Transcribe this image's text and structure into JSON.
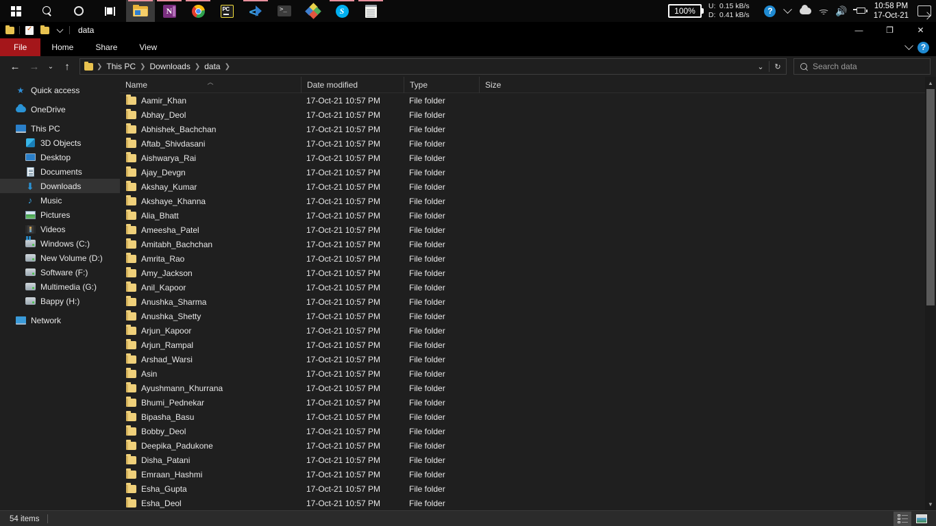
{
  "taskbar": {
    "start_icon": "windows-logo-icon",
    "items": [
      {
        "name": "start-button",
        "icon": "windows-logo-icon",
        "label": "Start"
      },
      {
        "name": "search-button",
        "icon": "search-icon",
        "label": "Search"
      },
      {
        "name": "cortana-button",
        "icon": "cortana-circle-icon",
        "label": "Cortana"
      },
      {
        "name": "task-view-button",
        "icon": "task-view-icon",
        "label": "Task View"
      }
    ],
    "apps": [
      {
        "name": "taskbar-app-file-explorer",
        "label": "File Explorer",
        "active": true
      },
      {
        "name": "taskbar-app-onenote",
        "label": "OneNote",
        "active": false
      },
      {
        "name": "taskbar-app-chrome",
        "label": "Google Chrome",
        "active": false
      },
      {
        "name": "taskbar-app-pycharm",
        "label": "PyCharm",
        "active": false
      },
      {
        "name": "taskbar-app-vscode",
        "label": "Visual Studio Code",
        "active": false
      },
      {
        "name": "taskbar-app-terminal",
        "label": "Terminal",
        "active": false
      },
      {
        "name": "taskbar-app-colorpicker",
        "label": "Color App",
        "active": false
      },
      {
        "name": "taskbar-app-skype",
        "label": "Skype",
        "active": false
      },
      {
        "name": "taskbar-app-notepad",
        "label": "Notepad",
        "active": false
      }
    ],
    "tray": {
      "battery_percent": "100%",
      "upload_label": "U:",
      "upload_value": "0.15 kB/s",
      "download_label": "D:",
      "download_value": "0.41 kB/s",
      "time": "10:58 PM",
      "date": "17-Oct-21",
      "icons": [
        "help-circle-icon",
        "chevron-up-icon",
        "onedrive-cloud-icon",
        "wifi-icon",
        "volume-icon",
        "battery-charging-icon",
        "action-center-icon"
      ]
    }
  },
  "window": {
    "title": "data",
    "quick_access": [
      "folder-icon",
      "properties-icon",
      "new-folder-icon",
      "customize-chevron-icon"
    ],
    "controls": {
      "minimize": "—",
      "maximize": "❐",
      "close": "✕"
    },
    "ribbon_tabs": [
      {
        "label": "File",
        "active": true
      },
      {
        "label": "Home",
        "active": false
      },
      {
        "label": "Share",
        "active": false
      },
      {
        "label": "View",
        "active": false
      }
    ],
    "ribbon_right": [
      "expand-ribbon-chevron-icon",
      "help-icon"
    ]
  },
  "nav": {
    "back": "←",
    "forward": "→",
    "recent": "⌄",
    "up": "↑",
    "breadcrumbs": [
      "This PC",
      "Downloads",
      "data"
    ],
    "dropdown": "⌄",
    "refresh": "↻"
  },
  "search": {
    "placeholder": "Search data",
    "icon": "search-icon"
  },
  "sidebar": {
    "groups": [
      {
        "items": [
          {
            "label": "Quick access",
            "icon": "star-icon",
            "indent": false,
            "selected": false
          }
        ]
      },
      {
        "items": [
          {
            "label": "OneDrive",
            "icon": "onedrive-cloud-icon",
            "indent": false,
            "selected": false
          }
        ]
      },
      {
        "items": [
          {
            "label": "This PC",
            "icon": "this-pc-icon",
            "indent": false,
            "selected": false
          },
          {
            "label": "3D Objects",
            "icon": "3d-objects-icon",
            "indent": true,
            "selected": false
          },
          {
            "label": "Desktop",
            "icon": "desktop-icon",
            "indent": true,
            "selected": false
          },
          {
            "label": "Documents",
            "icon": "documents-icon",
            "indent": true,
            "selected": false
          },
          {
            "label": "Downloads",
            "icon": "downloads-icon",
            "indent": true,
            "selected": true
          },
          {
            "label": "Music",
            "icon": "music-icon",
            "indent": true,
            "selected": false
          },
          {
            "label": "Pictures",
            "icon": "pictures-icon",
            "indent": true,
            "selected": false
          },
          {
            "label": "Videos",
            "icon": "videos-icon",
            "indent": true,
            "selected": false
          },
          {
            "label": "Windows (C:)",
            "icon": "windows-drive-icon",
            "indent": true,
            "selected": false
          },
          {
            "label": "New Volume (D:)",
            "icon": "drive-icon",
            "indent": true,
            "selected": false
          },
          {
            "label": "Software (F:)",
            "icon": "drive-icon",
            "indent": true,
            "selected": false
          },
          {
            "label": "Multimedia (G:)",
            "icon": "drive-icon",
            "indent": true,
            "selected": false
          },
          {
            "label": "Bappy (H:)",
            "icon": "drive-icon",
            "indent": true,
            "selected": false
          }
        ]
      },
      {
        "items": [
          {
            "label": "Network",
            "icon": "network-icon",
            "indent": false,
            "selected": false
          }
        ]
      }
    ]
  },
  "filelist": {
    "columns": [
      {
        "label": "Name",
        "sorted": true,
        "sort_direction": "ascending"
      },
      {
        "label": "Date modified",
        "sorted": false
      },
      {
        "label": "Type",
        "sorted": false
      },
      {
        "label": "Size",
        "sorted": false
      }
    ],
    "rows": [
      {
        "name": "Aamir_Khan",
        "date": "17-Oct-21 10:57 PM",
        "type": "File folder",
        "size": ""
      },
      {
        "name": "Abhay_Deol",
        "date": "17-Oct-21 10:57 PM",
        "type": "File folder",
        "size": ""
      },
      {
        "name": "Abhishek_Bachchan",
        "date": "17-Oct-21 10:57 PM",
        "type": "File folder",
        "size": ""
      },
      {
        "name": "Aftab_Shivdasani",
        "date": "17-Oct-21 10:57 PM",
        "type": "File folder",
        "size": ""
      },
      {
        "name": "Aishwarya_Rai",
        "date": "17-Oct-21 10:57 PM",
        "type": "File folder",
        "size": ""
      },
      {
        "name": "Ajay_Devgn",
        "date": "17-Oct-21 10:57 PM",
        "type": "File folder",
        "size": ""
      },
      {
        "name": "Akshay_Kumar",
        "date": "17-Oct-21 10:57 PM",
        "type": "File folder",
        "size": ""
      },
      {
        "name": "Akshaye_Khanna",
        "date": "17-Oct-21 10:57 PM",
        "type": "File folder",
        "size": ""
      },
      {
        "name": "Alia_Bhatt",
        "date": "17-Oct-21 10:57 PM",
        "type": "File folder",
        "size": ""
      },
      {
        "name": "Ameesha_Patel",
        "date": "17-Oct-21 10:57 PM",
        "type": "File folder",
        "size": ""
      },
      {
        "name": "Amitabh_Bachchan",
        "date": "17-Oct-21 10:57 PM",
        "type": "File folder",
        "size": ""
      },
      {
        "name": "Amrita_Rao",
        "date": "17-Oct-21 10:57 PM",
        "type": "File folder",
        "size": ""
      },
      {
        "name": "Amy_Jackson",
        "date": "17-Oct-21 10:57 PM",
        "type": "File folder",
        "size": ""
      },
      {
        "name": "Anil_Kapoor",
        "date": "17-Oct-21 10:57 PM",
        "type": "File folder",
        "size": ""
      },
      {
        "name": "Anushka_Sharma",
        "date": "17-Oct-21 10:57 PM",
        "type": "File folder",
        "size": ""
      },
      {
        "name": "Anushka_Shetty",
        "date": "17-Oct-21 10:57 PM",
        "type": "File folder",
        "size": ""
      },
      {
        "name": "Arjun_Kapoor",
        "date": "17-Oct-21 10:57 PM",
        "type": "File folder",
        "size": ""
      },
      {
        "name": "Arjun_Rampal",
        "date": "17-Oct-21 10:57 PM",
        "type": "File folder",
        "size": ""
      },
      {
        "name": "Arshad_Warsi",
        "date": "17-Oct-21 10:57 PM",
        "type": "File folder",
        "size": ""
      },
      {
        "name": "Asin",
        "date": "17-Oct-21 10:57 PM",
        "type": "File folder",
        "size": ""
      },
      {
        "name": "Ayushmann_Khurrana",
        "date": "17-Oct-21 10:57 PM",
        "type": "File folder",
        "size": ""
      },
      {
        "name": "Bhumi_Pednekar",
        "date": "17-Oct-21 10:57 PM",
        "type": "File folder",
        "size": ""
      },
      {
        "name": "Bipasha_Basu",
        "date": "17-Oct-21 10:57 PM",
        "type": "File folder",
        "size": ""
      },
      {
        "name": "Bobby_Deol",
        "date": "17-Oct-21 10:57 PM",
        "type": "File folder",
        "size": ""
      },
      {
        "name": "Deepika_Padukone",
        "date": "17-Oct-21 10:57 PM",
        "type": "File folder",
        "size": ""
      },
      {
        "name": "Disha_Patani",
        "date": "17-Oct-21 10:57 PM",
        "type": "File folder",
        "size": ""
      },
      {
        "name": "Emraan_Hashmi",
        "date": "17-Oct-21 10:57 PM",
        "type": "File folder",
        "size": ""
      },
      {
        "name": "Esha_Gupta",
        "date": "17-Oct-21 10:57 PM",
        "type": "File folder",
        "size": ""
      },
      {
        "name": "Esha_Deol",
        "date": "17-Oct-21 10:57 PM",
        "type": "File folder",
        "size": ""
      }
    ]
  },
  "status": {
    "item_count": "54 items",
    "views": [
      {
        "name": "details-view-button",
        "label": "Details view",
        "selected": true
      },
      {
        "name": "large-icons-view-button",
        "label": "Large icons view",
        "selected": false
      }
    ]
  }
}
